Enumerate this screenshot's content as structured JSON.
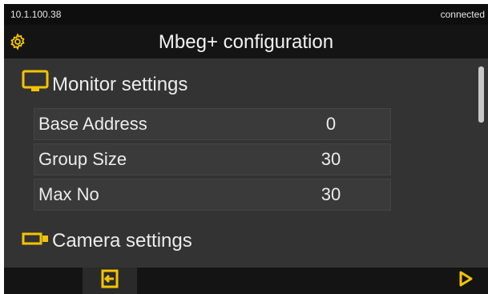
{
  "status": {
    "ip": "10.1.100.38",
    "connection": "connected"
  },
  "header": {
    "title": "Mbeg+ configuration",
    "settings_icon": "gear-icon"
  },
  "monitor": {
    "title": "Monitor settings",
    "icon": "monitor-icon",
    "rows": [
      {
        "label": "Base Address",
        "value": "0"
      },
      {
        "label": "Group Size",
        "value": "30"
      },
      {
        "label": "Max No",
        "value": "30"
      }
    ]
  },
  "camera": {
    "title": "Camera settings",
    "icon": "camera-icon"
  },
  "footer": {
    "exit_icon": "exit-icon",
    "next_icon": "play-icon"
  },
  "colors": {
    "accent": "#f4c400",
    "background": "#333334",
    "bar": "#141414"
  }
}
